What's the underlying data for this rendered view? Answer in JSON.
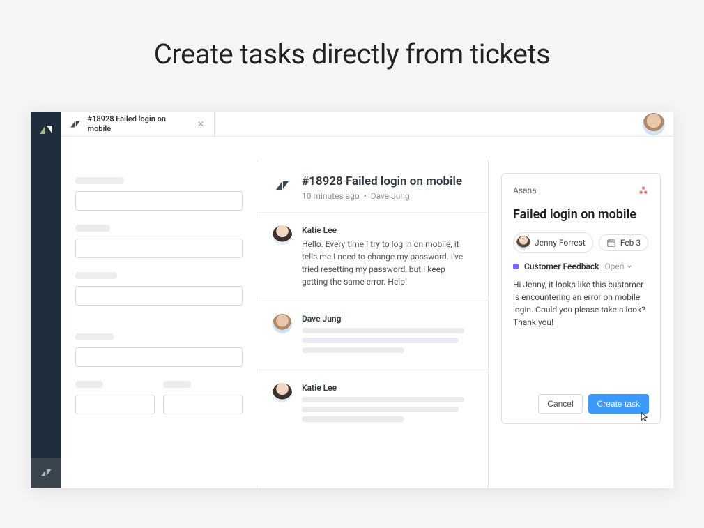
{
  "hero": {
    "title": "Create tasks directly from tickets"
  },
  "tab": {
    "title": "#18928 Failed login on mobile"
  },
  "ticket": {
    "title": "#18928 Failed login on mobile",
    "meta_time": "10 minutes ago",
    "meta_separator": "•",
    "meta_author": "Dave Jung"
  },
  "messages": [
    {
      "author": "Katie Lee",
      "text": "Hello. Every time I try to log in on mobile, it tells me I need to change my password. I've tried resetting my password, but I keep getting the same error. Help!"
    },
    {
      "author": "Dave Jung",
      "text": ""
    },
    {
      "author": "Katie Lee",
      "text": ""
    }
  ],
  "asana": {
    "header": "Asana",
    "title": "Failed login on mobile",
    "assignee": "Jenny Forrest",
    "date": "Feb 3",
    "tag": "Customer Feedback",
    "status": "Open",
    "description": "Hi Jenny, it looks like this customer is encountering an error on mobile login. Could you please take a look? Thank you!",
    "cancel": "Cancel",
    "create": "Create task"
  }
}
